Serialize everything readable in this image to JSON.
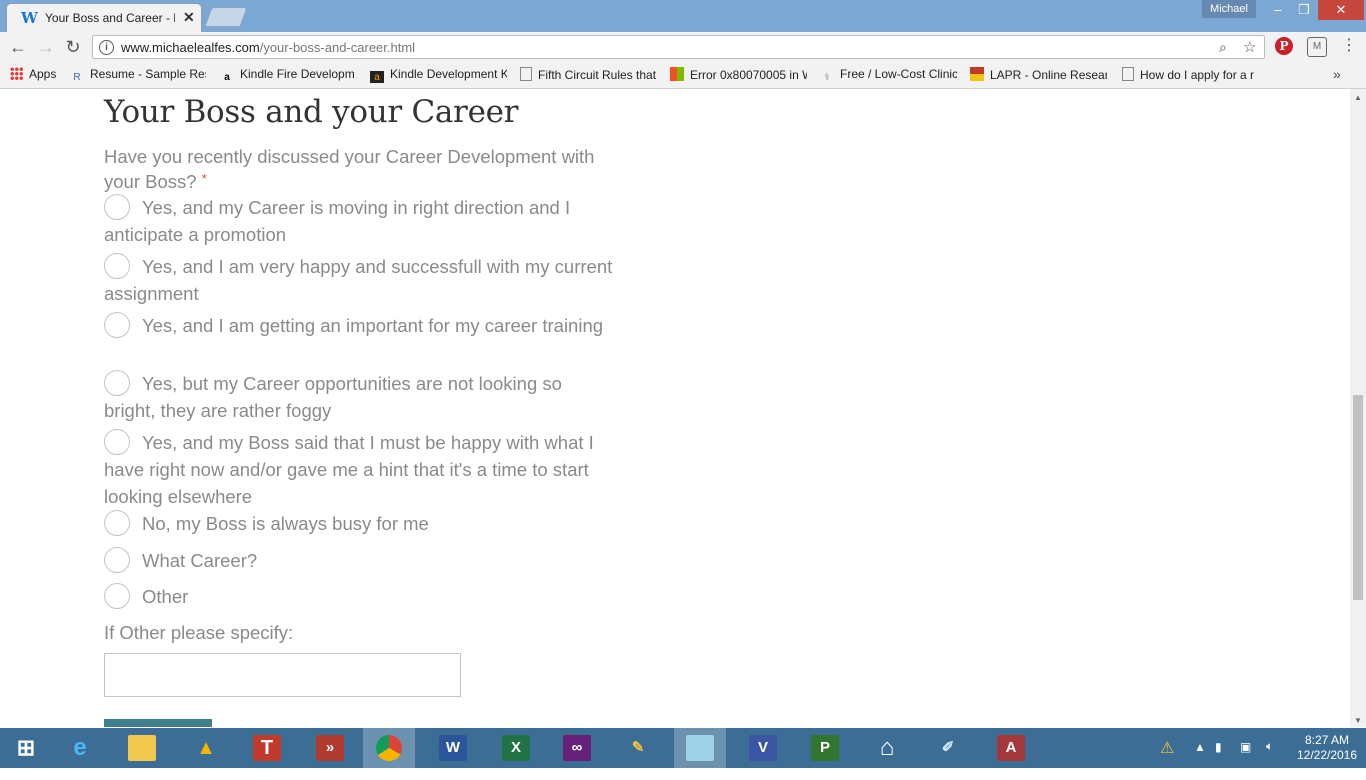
{
  "browser": {
    "tab_title": "Your Boss and Career - D",
    "profile_name": "Michael",
    "url_host": "www.michaelealfes.com",
    "url_path": "/your-boss-and-career.html",
    "bookmarks": [
      "Apps",
      "Resume - Sample Res",
      "Kindle Fire Developm",
      "Kindle Development K",
      "Fifth Circuit Rules that",
      "Error 0x80070005 in W",
      "Free / Low-Cost Clinic",
      "LAPR - Online Researc",
      "How do I apply for a r"
    ]
  },
  "form": {
    "title": "Your Boss and your Career",
    "question": "Have you recently discussed your Career Development with your Boss?",
    "required_mark": "*",
    "options": [
      "Yes, and my Career is moving in right direction and I anticipate a promotion",
      "Yes, and I am very happy and successfull with my current assignment",
      "Yes, and I am getting an important for my career training",
      "Yes, but my Career opportunities are not looking so bright, they are rather foggy",
      "Yes, and my Boss said that I must be happy with what I have right now and/or gave me a hint that it's a time to start looking elsewhere",
      "No, my Boss is always busy for me",
      "What Career?",
      "Other"
    ],
    "other_label": "If Other please specify:",
    "other_value": ""
  },
  "taskbar": {
    "time": "8:27 AM",
    "date": "12/22/2016"
  },
  "colors": {
    "titlebar": "#7aa7d4",
    "taskbar": "#3c6e95",
    "form_text": "#8a8a8a",
    "submit_button": "#417d8c"
  }
}
